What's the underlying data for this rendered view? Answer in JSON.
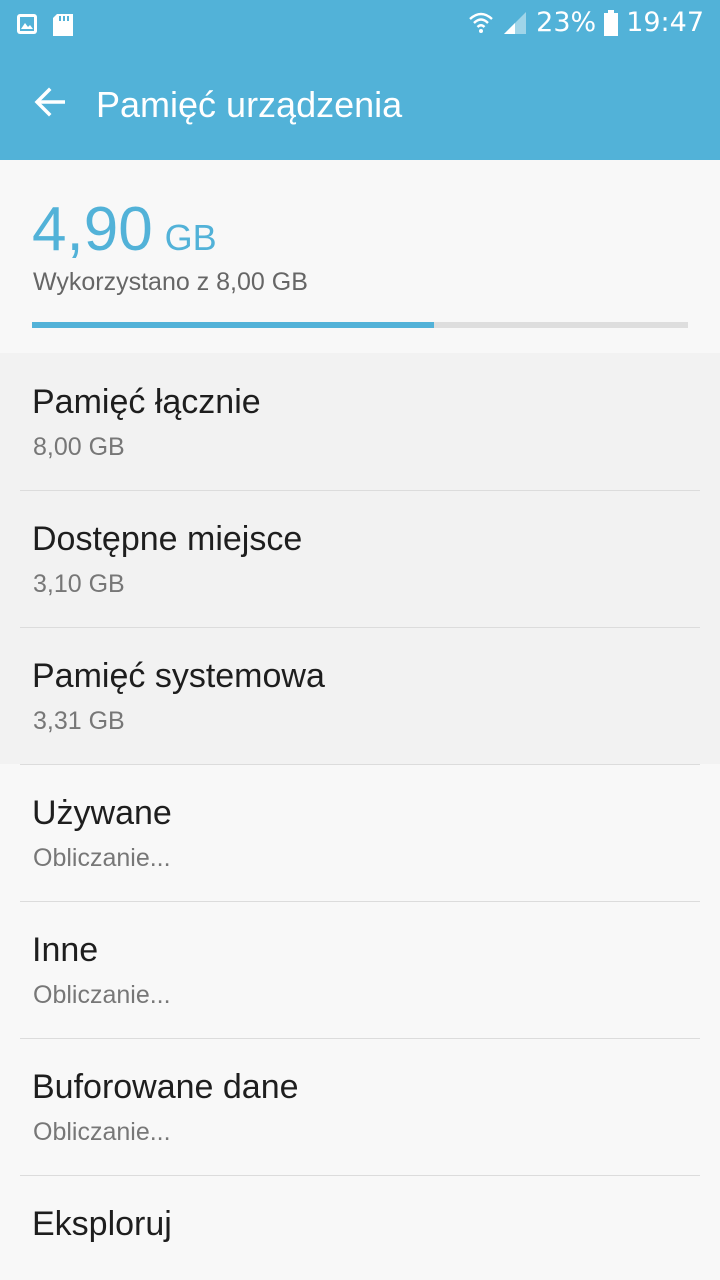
{
  "status_bar": {
    "battery": "23%",
    "time": "19:47",
    "icons": [
      "gallery-icon",
      "sd-card-icon",
      "wifi-icon",
      "signal-icon",
      "battery-icon"
    ]
  },
  "app_bar": {
    "title": "Pamięć urządzenia",
    "back_icon": "arrow-left-icon",
    "color": "#52b2d8"
  },
  "summary": {
    "used_value": "4,90",
    "used_unit": "GB",
    "used_caption": "Wykorzystano z 8,00 GB",
    "used_fraction": 0.6125
  },
  "items": [
    {
      "title": "Pamięć łącznie",
      "subtitle": "8,00 GB"
    },
    {
      "title": "Dostępne miejsce",
      "subtitle": "3,10 GB"
    },
    {
      "title": "Pamięć systemowa",
      "subtitle": "3,31 GB"
    },
    {
      "title": "Używane",
      "subtitle": "Obliczanie..."
    },
    {
      "title": "Inne",
      "subtitle": "Obliczanie..."
    },
    {
      "title": "Buforowane dane",
      "subtitle": "Obliczanie..."
    },
    {
      "title": "Eksploruj"
    }
  ]
}
